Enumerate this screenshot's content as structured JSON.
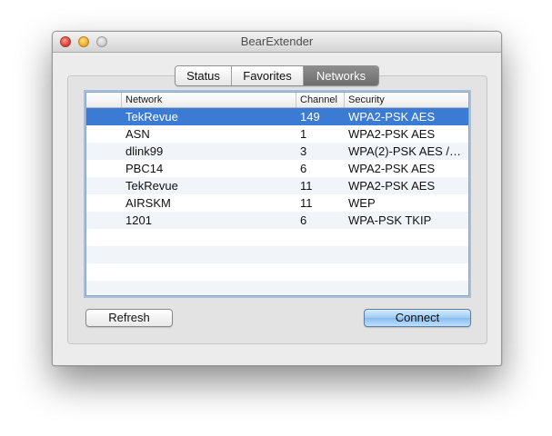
{
  "window": {
    "title": "BearExtender"
  },
  "tabs": [
    {
      "label": "Status"
    },
    {
      "label": "Favorites"
    },
    {
      "label": "Networks"
    }
  ],
  "table": {
    "headers": {
      "network": "Network",
      "channel": "Channel",
      "security": "Security"
    },
    "rows": [
      {
        "network": "TekRevue",
        "channel": "149",
        "security": "WPA2-PSK AES"
      },
      {
        "network": "ASN",
        "channel": "1",
        "security": "WPA2-PSK AES"
      },
      {
        "network": "dlink99",
        "channel": "3",
        "security": "WPA(2)-PSK AES /…"
      },
      {
        "network": "PBC14",
        "channel": "6",
        "security": "WPA2-PSK AES"
      },
      {
        "network": "TekRevue",
        "channel": "11",
        "security": "WPA2-PSK AES"
      },
      {
        "network": "AIRSKM",
        "channel": "11",
        "security": "WEP"
      },
      {
        "network": "1201",
        "channel": "6",
        "security": "WPA-PSK TKIP"
      }
    ]
  },
  "buttons": {
    "refresh": "Refresh",
    "connect": "Connect"
  },
  "icons": {
    "close": "close-icon",
    "minimize": "minimize-icon",
    "zoom": "zoom-icon"
  },
  "colors": {
    "selection": "#3b7bd4",
    "active_tab": "#7a7a7a",
    "default_button": "#9fcbf4"
  }
}
